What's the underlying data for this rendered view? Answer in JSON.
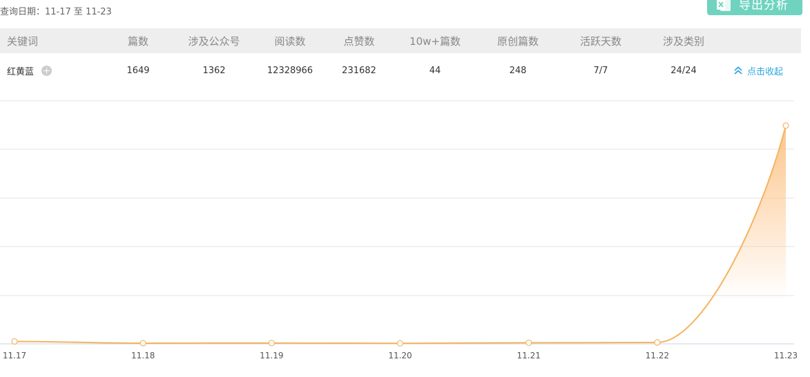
{
  "query": {
    "label": "查询日期：",
    "range": "11-17 至 11-23"
  },
  "export_button": {
    "icon": "excel-icon",
    "label": "导出分析",
    "color": "#6fd3c0"
  },
  "table": {
    "headers": [
      "关键词",
      "篇数",
      "涉及公众号",
      "阅读数",
      "点赞数",
      "10w+篇数",
      "原创篇数",
      "活跃天数",
      "涉及类别"
    ],
    "rows": [
      {
        "keyword": "红黄蓝",
        "articles": "1649",
        "accounts": "1362",
        "reads": "12328966",
        "likes": "231682",
        "viral": "44",
        "original": "248",
        "active_days": "7/7",
        "categories": "24/24",
        "add_icon": "plus-circle-icon",
        "collapse_label": "点击收起",
        "collapse_icon": "double-chevron-up-icon"
      }
    ]
  },
  "chart_data": {
    "type": "area",
    "x": [
      "11.17",
      "11.18",
      "11.19",
      "11.20",
      "11.21",
      "11.22",
      "11.23"
    ],
    "series": [
      {
        "values": [
          18,
          5,
          6,
          4,
          8,
          10,
          1600
        ]
      }
    ],
    "ylim": [
      0,
      1650
    ],
    "grid": true,
    "legend": "none",
    "colors": {
      "line": "#f6b35f",
      "fill": "#fcc58a",
      "grid": "#e3e3e3",
      "axis": "#c8d3e0"
    }
  },
  "colors": {
    "accent": "#2ea7e0",
    "header_bg": "#eeeeee"
  }
}
